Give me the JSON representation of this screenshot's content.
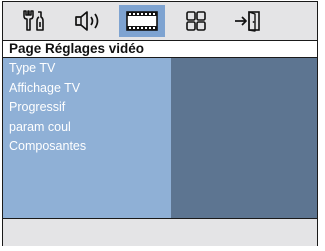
{
  "toolbar": {
    "tabs": [
      {
        "icon": "settings-tools-icon",
        "active": false
      },
      {
        "icon": "speaker-icon",
        "active": false
      },
      {
        "icon": "film-video-icon",
        "active": true
      },
      {
        "icon": "grid-preference-icon",
        "active": false
      },
      {
        "icon": "exit-door-icon",
        "active": false
      }
    ],
    "active_color": "#7ea3d1"
  },
  "page": {
    "title": "Page Réglages vidéo"
  },
  "menu": {
    "items": [
      {
        "label": "Type TV"
      },
      {
        "label": "Affichage TV"
      },
      {
        "label": "Progressif"
      },
      {
        "label": "param coul"
      },
      {
        "label": "Composantes"
      }
    ]
  },
  "colors": {
    "panel_left": "#8fb0d6",
    "panel_right": "#5d7591",
    "background": "#e4e4e6"
  }
}
